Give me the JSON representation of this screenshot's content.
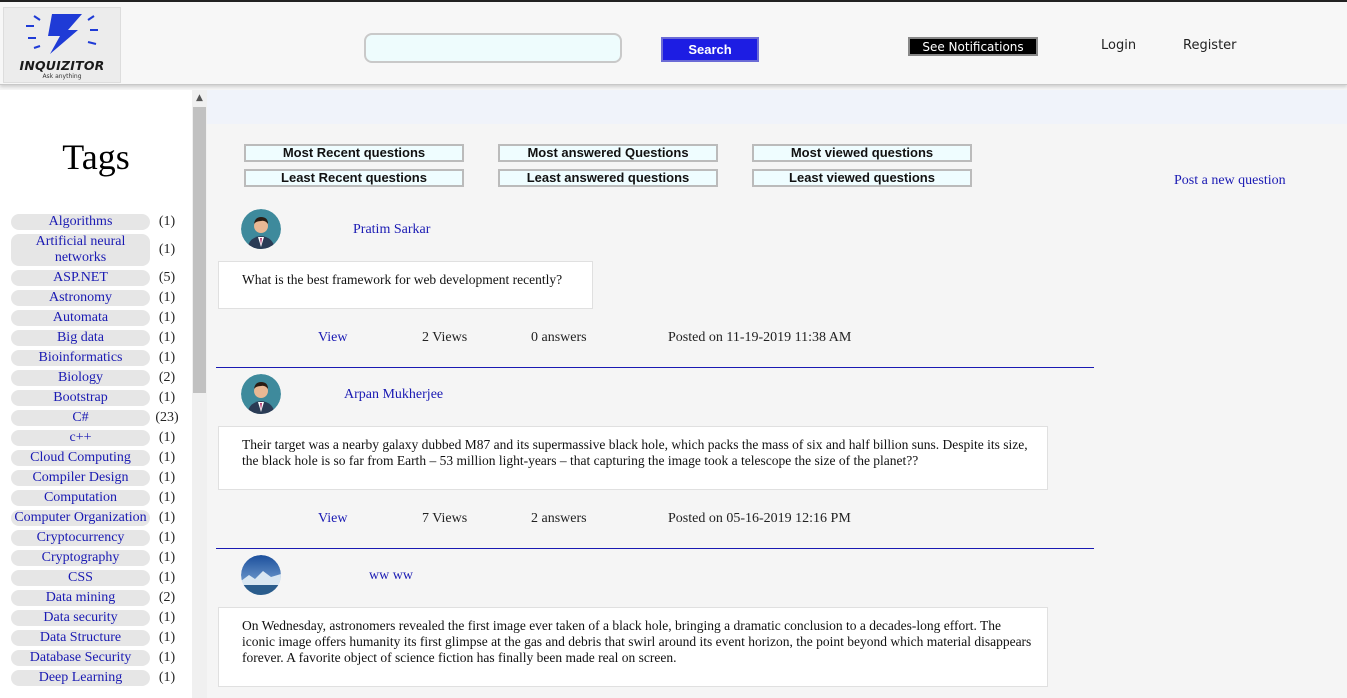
{
  "header": {
    "logo_name": "INQUIZITOR",
    "logo_tagline": "Ask anything",
    "search_placeholder": "",
    "search_button": "Search",
    "notifications_button": "See Notifications",
    "login": "Login",
    "register": "Register"
  },
  "sidebar": {
    "title": "Tags",
    "tags": [
      {
        "label": "Algorithms",
        "count": "(1)"
      },
      {
        "label": "Artificial neural networks",
        "count": "(1)"
      },
      {
        "label": "ASP.NET",
        "count": "(5)"
      },
      {
        "label": "Astronomy",
        "count": "(1)"
      },
      {
        "label": "Automata",
        "count": "(1)"
      },
      {
        "label": "Big data",
        "count": "(1)"
      },
      {
        "label": "Bioinformatics",
        "count": "(1)"
      },
      {
        "label": "Biology",
        "count": "(2)"
      },
      {
        "label": "Bootstrap",
        "count": "(1)"
      },
      {
        "label": "C#",
        "count": "(23)"
      },
      {
        "label": "c++",
        "count": "(1)"
      },
      {
        "label": "Cloud Computing",
        "count": "(1)"
      },
      {
        "label": "Compiler Design",
        "count": "(1)"
      },
      {
        "label": "Computation",
        "count": "(1)"
      },
      {
        "label": "Computer Organization",
        "count": "(1)"
      },
      {
        "label": "Cryptocurrency",
        "count": "(1)"
      },
      {
        "label": "Cryptography",
        "count": "(1)"
      },
      {
        "label": "CSS",
        "count": "(1)"
      },
      {
        "label": "Data mining",
        "count": "(2)"
      },
      {
        "label": "Data security",
        "count": "(1)"
      },
      {
        "label": "Data Structure",
        "count": "(1)"
      },
      {
        "label": "Database Security",
        "count": "(1)"
      },
      {
        "label": "Deep Learning",
        "count": "(1)"
      }
    ]
  },
  "sort_buttons": {
    "most_recent": "Most Recent questions",
    "most_answered": "Most answered Questions",
    "most_viewed": "Most viewed questions",
    "least_recent": "Least Recent questions",
    "least_answered": "Least answered questions",
    "least_viewed": "Least viewed questions"
  },
  "post_new": "Post a new question",
  "questions": [
    {
      "author": "Pratim Sarkar",
      "text": "What is the best framework for web development recently?",
      "view": "View",
      "views": "2 Views",
      "answers": "0 answers",
      "posted": "Posted on 11-19-2019 11:38 AM"
    },
    {
      "author": "Arpan Mukherjee",
      "text": "Their target was a nearby galaxy dubbed M87 and its supermassive black hole, which packs the mass of six and half billion suns. Despite its size, the black hole is so far from Earth – 53 million light-years – that capturing the image took a telescope the size of the planet??",
      "view": "View",
      "views": "7 Views",
      "answers": "2 answers",
      "posted": "Posted on 05-16-2019 12:16 PM"
    },
    {
      "author": "ww ww",
      "text": "On Wednesday, astronomers revealed the first image ever taken of a black hole, bringing a dramatic conclusion to a decades-long effort. The iconic image offers humanity its first glimpse at the gas and debris that swirl around its event horizon, the point beyond which material disappears forever. A favorite object of science fiction has finally been made real on screen."
    }
  ],
  "colors": {
    "link": "#1a1ab3",
    "search_button": "#1d1de3",
    "divider": "#1a1ab3"
  }
}
